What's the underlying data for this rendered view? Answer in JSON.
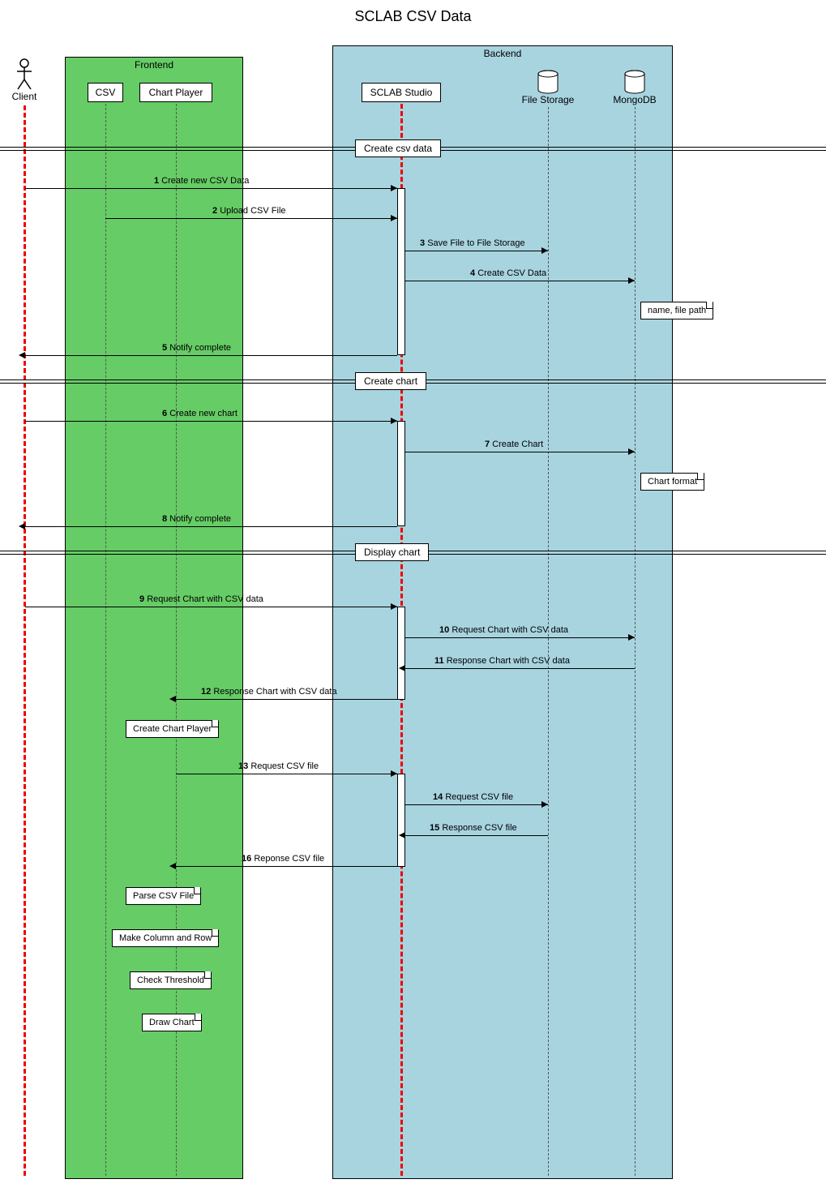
{
  "title": "SCLAB CSV Data",
  "groups": {
    "frontend": "Frontend",
    "backend": "Backend"
  },
  "actors": {
    "client": "Client",
    "csv": "CSV",
    "chartplayer": "Chart Player",
    "studio": "SCLAB Studio",
    "filestorage": "File Storage",
    "mongodb": "MongoDB"
  },
  "dividers": {
    "d1": "Create csv data",
    "d2": "Create chart",
    "d3": "Display chart"
  },
  "messages": {
    "m1": {
      "n": "1",
      "t": "Create new CSV Data"
    },
    "m2": {
      "n": "2",
      "t": "Upload CSV File"
    },
    "m3": {
      "n": "3",
      "t": "Save File to File Storage"
    },
    "m4": {
      "n": "4",
      "t": "Create CSV Data"
    },
    "m5": {
      "n": "5",
      "t": "Notify complete"
    },
    "m6": {
      "n": "6",
      "t": "Create new chart"
    },
    "m7": {
      "n": "7",
      "t": "Create Chart"
    },
    "m8": {
      "n": "8",
      "t": "Notify complete"
    },
    "m9": {
      "n": "9",
      "t": "Request Chart with CSV data"
    },
    "m10": {
      "n": "10",
      "t": "Request Chart with CSV data"
    },
    "m11": {
      "n": "11",
      "t": "Response Chart with CSV data"
    },
    "m12": {
      "n": "12",
      "t": "Response Chart with CSV data"
    },
    "m13": {
      "n": "13",
      "t": "Request CSV file"
    },
    "m14": {
      "n": "14",
      "t": "Request CSV file"
    },
    "m15": {
      "n": "15",
      "t": "Response CSV file"
    },
    "m16": {
      "n": "16",
      "t": "Reponse CSV file"
    }
  },
  "notes": {
    "n1": "name, file path",
    "n2": "Chart format",
    "n3": "Create Chart Player",
    "n4": "Parse CSV File",
    "n5": "Make Column and Row",
    "n6": "Check Threshold",
    "n7": "Draw Chart"
  }
}
